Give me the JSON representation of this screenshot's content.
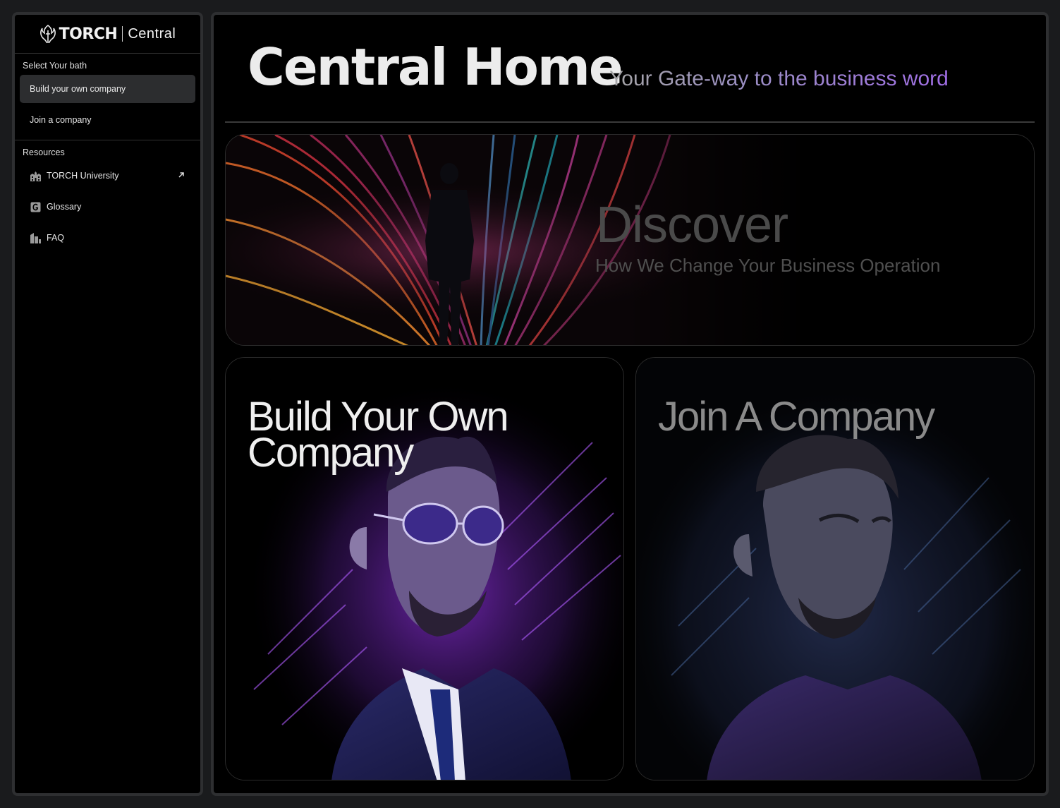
{
  "sidebar": {
    "logo": {
      "name": "TORCH",
      "product": "Central"
    },
    "path_section": {
      "title": "Select Your bath",
      "items": [
        {
          "label": "Build your own company",
          "active": true
        },
        {
          "label": "Join a company",
          "active": false
        }
      ]
    },
    "resources_section": {
      "title": "Resources",
      "items": [
        {
          "label": "TORCH University",
          "icon": "university-icon",
          "external": true
        },
        {
          "label": "Glossary",
          "icon": "glossary-icon"
        },
        {
          "label": "FAQ",
          "icon": "faq-icon"
        }
      ]
    }
  },
  "header": {
    "title": "Central Home",
    "subtitle": "Your Gate-way to the business word"
  },
  "cards": {
    "discover": {
      "title": "Discover",
      "subtitle": "How We Change Your Business Operation"
    },
    "build": {
      "title": "Build Your Own Company"
    },
    "join": {
      "title": "Join A Company"
    }
  },
  "colors": {
    "background": "#000000",
    "frame": "#2e2f31",
    "accent_purple": "#a06ee6",
    "active_item": "#2c2d2f"
  }
}
